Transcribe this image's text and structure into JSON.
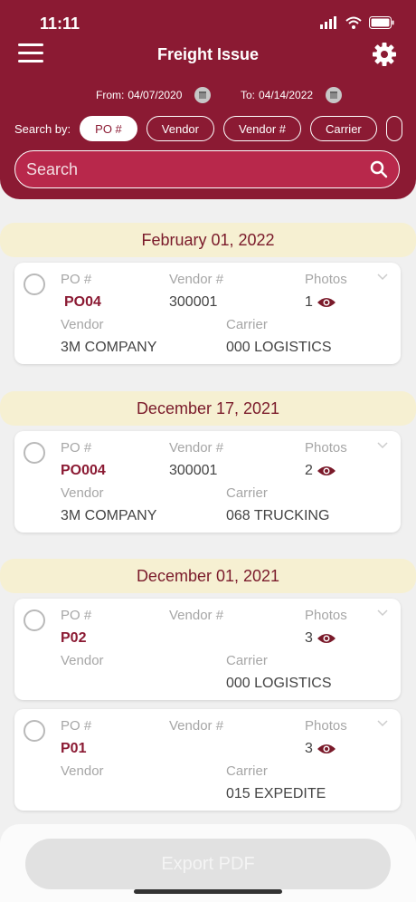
{
  "status_bar": {
    "time": "11:11"
  },
  "header": {
    "title": "Freight Issue",
    "from_label": "From:",
    "from_date": "04/07/2020",
    "to_label": "To:",
    "to_date": "04/14/2022",
    "search_by_label": "Search by:",
    "filters": [
      "PO #",
      "Vendor",
      "Vendor #",
      "Carrier"
    ],
    "active_filter": "PO #",
    "search_placeholder": "Search"
  },
  "labels": {
    "po": "PO #",
    "vendor_num": "Vendor #",
    "photos": "Photos",
    "vendor": "Vendor",
    "carrier": "Carrier"
  },
  "groups": [
    {
      "date": "February 01, 2022",
      "items": [
        {
          "po": "PO04",
          "vendor_num": "300001",
          "photos": "1",
          "vendor": "3M COMPANY",
          "carrier": "000 LOGISTICS"
        }
      ]
    },
    {
      "date": "December 17, 2021",
      "items": [
        {
          "po": "PO004",
          "vendor_num": "300001",
          "photos": "2",
          "vendor": "3M COMPANY",
          "carrier": "068 TRUCKING"
        }
      ]
    },
    {
      "date": "December 01, 2021",
      "items": [
        {
          "po": "P02",
          "vendor_num": "",
          "photos": "3",
          "vendor": "",
          "carrier": "000 LOGISTICS"
        },
        {
          "po": "P01",
          "vendor_num": "",
          "photos": "3",
          "vendor": "",
          "carrier": "015 EXPEDITE"
        }
      ]
    }
  ],
  "footer": {
    "export_label": "Export PDF"
  },
  "colors": {
    "brand": "#8b1a33",
    "section_bg": "#f6f0d2",
    "search_bg": "#b8284b"
  }
}
